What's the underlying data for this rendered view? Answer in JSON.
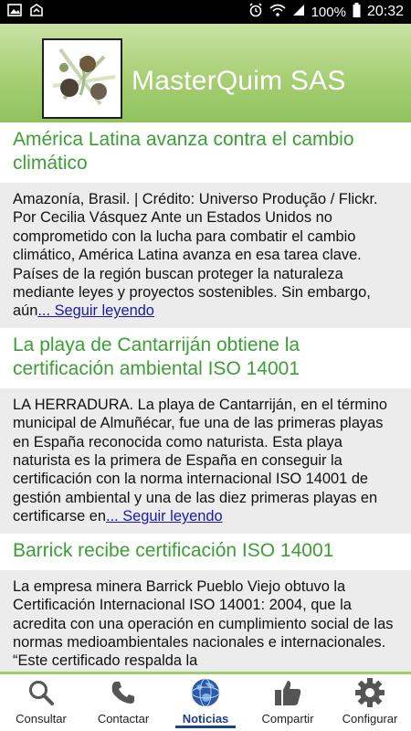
{
  "status_bar": {
    "battery_percent": "100%",
    "time": "20:32"
  },
  "header": {
    "title": "MasterQuim SAS"
  },
  "articles": [
    {
      "title": "América Latina avanza contra el cambio climático",
      "excerpt": "Amazonía, Brasil. | Crédito: Universo Produção / Flickr. Por Cecilia Vásquez Ante un Estados Unidos no comprometido con la lucha para combatir el cambio climático, América Latina avanza en esa tarea clave. Países de la región buscan proteger la naturaleza mediante leyes y proyectos sostenibles. Sin embargo, aún",
      "read_more": "... Seguir leyendo"
    },
    {
      "title": "La playa de Cantarriján obtiene la certificación ambiental ISO 14001",
      "excerpt": "LA HERRADURA. La playa de Cantarriján, en el término municipal de Almuñécar, fue una de las primeras playas en España reconocida como naturista. Esta playa naturista es la primera de España en conseguir la certificación con la norma internacional ISO 14001 de gestión ambiental y una de las diez primeras playas en certificarse en",
      "read_more": "... Seguir leyendo"
    },
    {
      "title": "Barrick recibe certificación ISO 14001",
      "excerpt": "La empresa minera Barrick Pueblo Viejo obtuvo la Certificación Internacional ISO 14001: 2004, que la acredita con una operación en cumplimiento social de las normas medioambientales nacionales e internacionales. “Este certificado respalda la",
      "read_more": ""
    }
  ],
  "bottom_nav": {
    "items": [
      {
        "label": "Consultar",
        "icon": "search-icon"
      },
      {
        "label": "Contactar",
        "icon": "phone-icon"
      },
      {
        "label": "Noticias",
        "icon": "globe-icon",
        "active": true
      },
      {
        "label": "Compartir",
        "icon": "thumbs-up-icon"
      },
      {
        "label": "Configurar",
        "icon": "gear-icon"
      }
    ]
  },
  "colors": {
    "header_green": "#a7cf74",
    "title_green": "#3aa033",
    "link_blue": "#1a1aa8",
    "active_blue": "#1e3f8c"
  }
}
